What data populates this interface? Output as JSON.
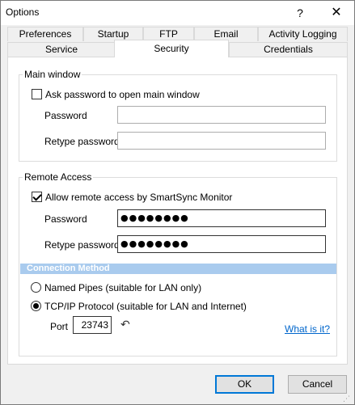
{
  "window": {
    "title": "Options",
    "help_glyph": "?",
    "close_glyph": "✕"
  },
  "tabs_row1": [
    {
      "label": "Preferences"
    },
    {
      "label": "Startup"
    },
    {
      "label": "FTP"
    },
    {
      "label": "Email"
    },
    {
      "label": "Activity Logging"
    }
  ],
  "tabs_row2": [
    {
      "label": "Service"
    },
    {
      "label": "Security",
      "active": true
    },
    {
      "label": "Credentials"
    }
  ],
  "main_window": {
    "group_label": "Main window",
    "ask_password_label": "Ask password to open main window",
    "ask_password_checked": false,
    "password_label": "Password",
    "password_value": "",
    "retype_label": "Retype password",
    "retype_value": ""
  },
  "remote_access": {
    "group_label": "Remote Access",
    "allow_label": "Allow remote access by SmartSync Monitor",
    "allow_checked": true,
    "password_label": "Password",
    "password_value": "●●●●●●●●",
    "retype_label": "Retype password",
    "retype_value": "●●●●●●●●",
    "connection_method_title": "Connection Method",
    "named_pipes_label": "Named Pipes (suitable for LAN only)",
    "tcpip_label": "TCP/IP Protocol (suitable for LAN and Internet)",
    "selected_method": "tcpip",
    "port_label": "Port",
    "port_value": "23743",
    "reset_icon_glyph": "↶",
    "what_is_it_label": "What is it?"
  },
  "buttons": {
    "ok": "OK",
    "cancel": "Cancel"
  },
  "colors": {
    "section_bar": "#a9cbee",
    "link": "#0066cc",
    "default_button_border": "#0078d7"
  },
  "icons": {
    "help": "help-icon",
    "close": "close-icon",
    "reset_port": "reset-icon",
    "resize_grip": "resize-grip-icon"
  }
}
